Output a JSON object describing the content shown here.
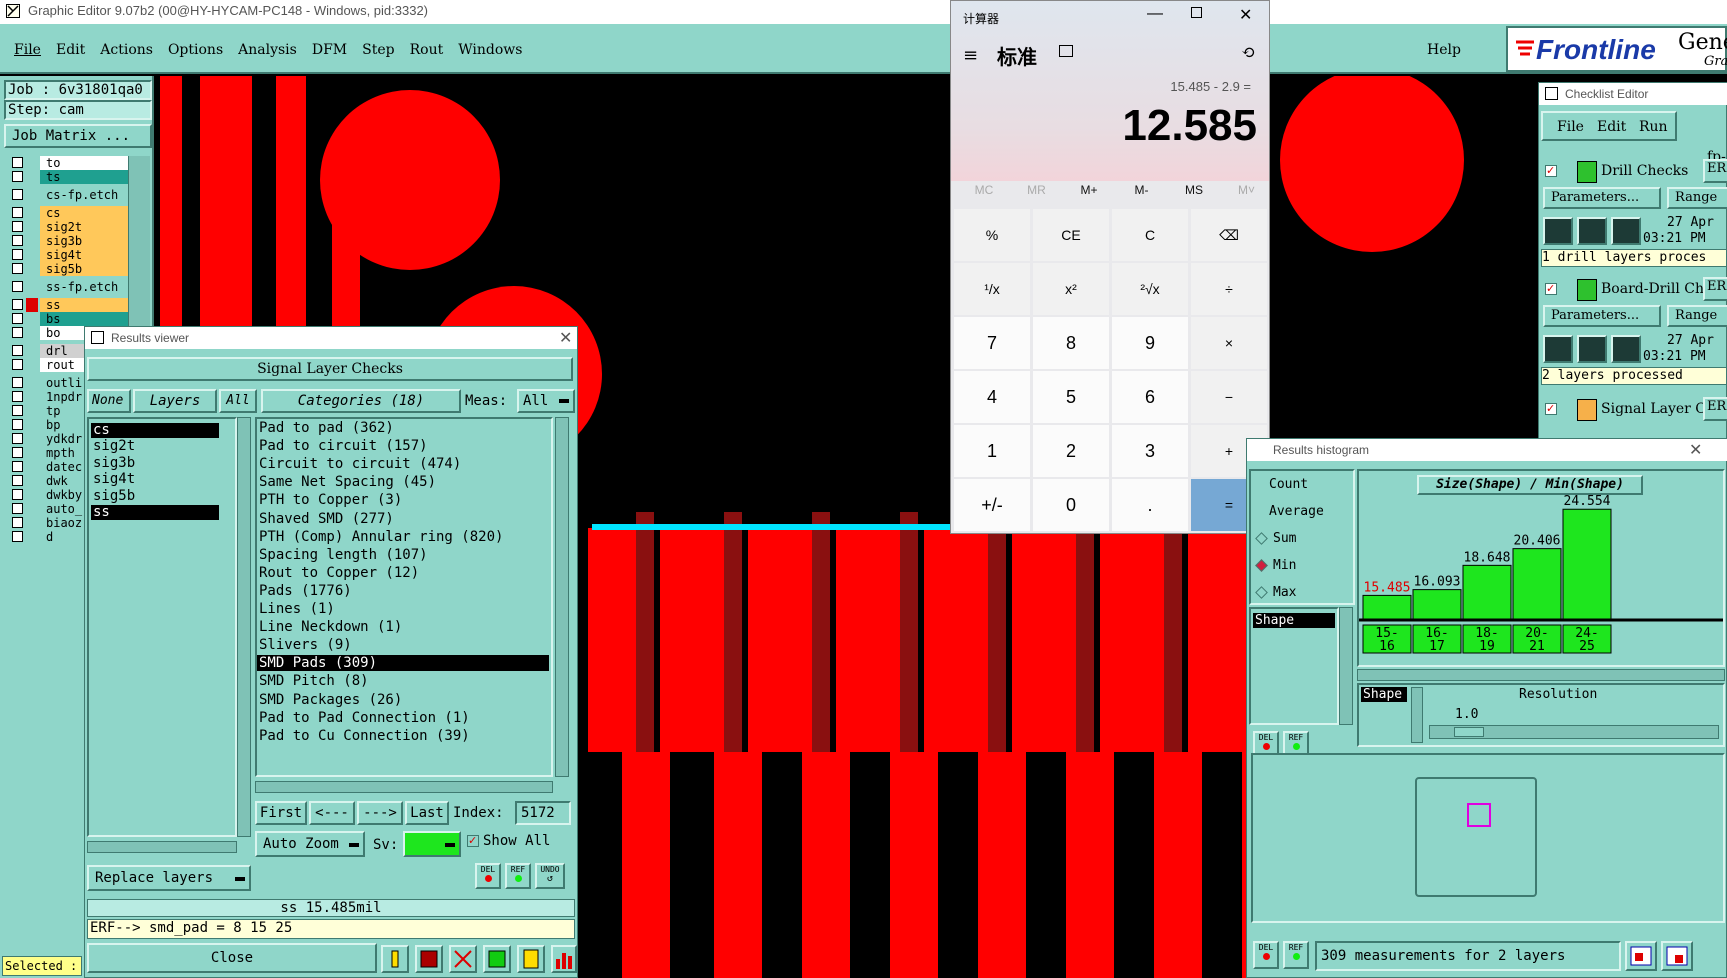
{
  "app": {
    "title": "Graphic Editor 9.07b2 (00@HY-HYCAM-PC148 - Windows, pid:3332)",
    "menu": [
      "File",
      "Edit",
      "Actions",
      "Options",
      "Analysis",
      "DFM",
      "Step",
      "Rout",
      "Windows"
    ],
    "help": "Help",
    "brand": "Frontline",
    "brand_extra": "Gene",
    "brand_sub": "Grap"
  },
  "left_panel": {
    "job": "Job : 6v31801qa0",
    "step": "Step: cam",
    "job_matrix": "Job Matrix ...",
    "layers": [
      {
        "name": "to",
        "color": "#ffffff"
      },
      {
        "name": "ts",
        "color": "#1fa090"
      },
      {
        "name": "cs-fp.etch",
        "color": "#8fd6c9"
      },
      {
        "name": "cs",
        "color": "#ffc85a"
      },
      {
        "name": "sig2t",
        "color": "#ffc85a"
      },
      {
        "name": "sig3b",
        "color": "#ffc85a"
      },
      {
        "name": "sig4t",
        "color": "#ffc85a"
      },
      {
        "name": "sig5b",
        "color": "#ffc85a"
      },
      {
        "name": "ss-fp.etch",
        "color": "#8fd6c9"
      },
      {
        "name": "ss",
        "color": "#ffc85a"
      },
      {
        "name": "bs",
        "color": "#1fa090"
      },
      {
        "name": "bo",
        "color": "#ffffff"
      },
      {
        "name": "drl",
        "color": "#d0d0d0"
      },
      {
        "name": "rout",
        "color": "#ffffff"
      },
      {
        "name": "outli",
        "color": "#8fd6c9"
      },
      {
        "name": "1npdr",
        "color": "#8fd6c9"
      },
      {
        "name": "tp",
        "color": "#8fd6c9"
      },
      {
        "name": "bp",
        "color": "#8fd6c9"
      },
      {
        "name": "ydkdr",
        "color": "#8fd6c9"
      },
      {
        "name": "mpth",
        "color": "#8fd6c9"
      },
      {
        "name": "datec",
        "color": "#8fd6c9"
      },
      {
        "name": "dwk",
        "color": "#8fd6c9"
      },
      {
        "name": "dwkby",
        "color": "#8fd6c9"
      },
      {
        "name": "auto_",
        "color": "#8fd6c9"
      },
      {
        "name": "biaoz",
        "color": "#8fd6c9"
      },
      {
        "name": "d",
        "color": "#8fd6c9"
      }
    ],
    "selected": "Selected :"
  },
  "results_viewer": {
    "title": "Results viewer",
    "heading": "Signal Layer Checks",
    "none": "None",
    "layers_btn": "Layers",
    "all": "All",
    "categories": "Categories (18)",
    "meas_label": "Meas:",
    "meas_value": "All",
    "layer_list": [
      "cs",
      "sig2t",
      "sig3b",
      "sig4t",
      "sig5b",
      "ss"
    ],
    "category_list": [
      "Pad to pad (362)",
      "Pad to circuit (157)",
      "Circuit to circuit (474)",
      "Same Net Spacing (45)",
      "PTH to Copper (3)",
      "Shaved SMD (277)",
      "PTH (Comp) Annular ring (820)",
      "Spacing length (107)",
      "Rout to Copper (12)",
      "Pads (1776)",
      "Lines (1)",
      "Line Neckdown (1)",
      "Slivers (9)",
      "SMD Pads (309)",
      "SMD Pitch (8)",
      "SMD Packages (26)",
      "Pad to Pad Connection (1)",
      "Pad to Cu Connection (39)"
    ],
    "selected_category": 13,
    "first": "First",
    "prev": "<---",
    "next": "--->",
    "last": "Last",
    "index_label": "Index:",
    "index_value": "5172",
    "auto_zoom": "Auto Zoom",
    "sv_label": "Sv:",
    "show_all": "Show All",
    "replace_layers": "Replace layers",
    "status": "ss 15.485mil",
    "erf": "ERF--> smd_pad = 8 15 25",
    "close": "Close",
    "del": "DEL",
    "ref": "REF",
    "undo": "UNDO"
  },
  "calculator": {
    "title": "计算器",
    "mode": "标准",
    "expression": "15.485 - 2.9 =",
    "result": "12.585",
    "memory": [
      "MC",
      "MR",
      "M+",
      "M-",
      "MS",
      "M˅"
    ],
    "keys": [
      [
        "%",
        "CE",
        "C",
        "⌫"
      ],
      [
        "¹/x",
        "x²",
        "²√x",
        "÷"
      ],
      [
        "7",
        "8",
        "9",
        "×"
      ],
      [
        "4",
        "5",
        "6",
        "−"
      ],
      [
        "1",
        "2",
        "3",
        "+"
      ],
      [
        "+/-",
        "0",
        ".",
        "="
      ]
    ]
  },
  "checklist": {
    "title": "Checklist Editor",
    "menu": [
      "File",
      "Edit",
      "Run"
    ],
    "fp": "fp-",
    "items": [
      {
        "name": "Drill Checks",
        "er": "ER",
        "params": "Parameters...",
        "range": "Range",
        "date": "27 Apr",
        "time": "03:21 PM",
        "status": "1 drill layers proces"
      },
      {
        "name": "Board-Drill Che",
        "er": "ER",
        "params": "Parameters...",
        "range": "Range",
        "date": "27 Apr",
        "time": "03:21 PM",
        "status": "2 layers processed"
      },
      {
        "name": "Signal Layer Ch",
        "er": "ER"
      }
    ]
  },
  "histogram": {
    "title": "Results histogram",
    "options": [
      "Count",
      "Average",
      "Sum",
      "Min",
      "Max"
    ],
    "selected_option": "Min",
    "chart_title": "Size(Shape) / Min(Shape)",
    "bins": [
      {
        "label": "15-16",
        "value": 15.485
      },
      {
        "label": "16-17",
        "value": 16.093
      },
      {
        "label": "18-19",
        "value": 18.648
      },
      {
        "label": "20-21",
        "value": 20.406
      },
      {
        "label": "24-25",
        "value": 24.554
      }
    ],
    "shape_item": "Shape",
    "shape_label": "Shape",
    "resolution_label": "Resolution",
    "resolution_value": "1.0",
    "status": "309 measurements for 2 layers",
    "del": "DEL",
    "ref": "REF"
  },
  "colors": {
    "panel": "#8fd6c9",
    "copper": "#ff0000",
    "highlight": "#00ffff",
    "bar": "#1ee61e"
  }
}
